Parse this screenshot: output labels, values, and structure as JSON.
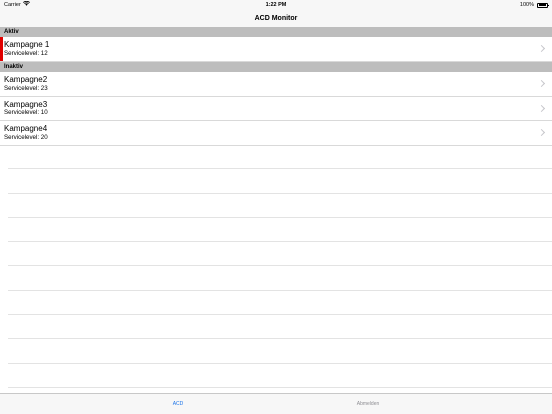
{
  "status_bar": {
    "carrier": "Carrier",
    "time": "1:22 PM",
    "battery": "100%"
  },
  "nav": {
    "title": "ACD Monitor"
  },
  "sections": [
    {
      "header": "Aktiv",
      "rows": [
        {
          "title": "Kampagne 1",
          "subtitle": "Servicelevel: 12",
          "marker_color": "#e00000"
        }
      ]
    },
    {
      "header": "Inaktiv",
      "rows": [
        {
          "title": "Kampagne2",
          "subtitle": "Servicelevel: 23"
        },
        {
          "title": "Kampagne3",
          "subtitle": "Servicelevel: 10"
        },
        {
          "title": "Kampagne4",
          "subtitle": "Servicelevel: 20"
        }
      ]
    }
  ],
  "tab_bar": {
    "tabs": [
      {
        "label": "ACD",
        "selected": true,
        "color": "#1a73e8"
      },
      {
        "label": "Abmelden",
        "selected": false,
        "color": "#8e8e93"
      }
    ]
  }
}
